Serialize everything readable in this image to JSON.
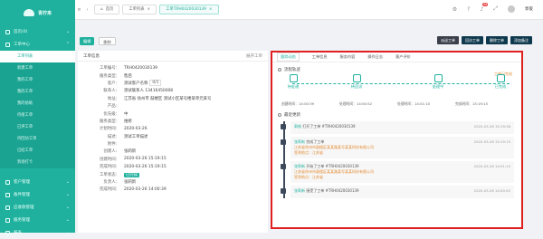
{
  "brand": "青柠来",
  "sidebar": {
    "items": [
      {
        "label": "首页(0)"
      },
      {
        "label": "工单中心"
      }
    ],
    "subitems": [
      {
        "label": "工单列表"
      },
      {
        "label": "新建工单"
      },
      {
        "label": "我的工单"
      },
      {
        "label": "我的工单"
      },
      {
        "label": "我的协助"
      },
      {
        "label": "待接工单"
      },
      {
        "label": "已评工单"
      },
      {
        "label": "待回访工单"
      },
      {
        "label": "已结工单"
      },
      {
        "label": "到场打卡"
      }
    ],
    "bottom": [
      {
        "label": "客户管理"
      },
      {
        "label": "备件管理"
      },
      {
        "label": "应收款管理"
      },
      {
        "label": "服务管理"
      },
      {
        "label": "报表"
      }
    ]
  },
  "topbar": {
    "home": "首页",
    "tab1": "工单列表",
    "tab2": "工单TRH0420030139",
    "badge": "99",
    "user": "郭俊"
  },
  "toolbar": {
    "edit": "编辑",
    "delete": "删除",
    "actions": [
      "派送工单",
      "回访工单",
      "删除工单",
      "添加备注"
    ]
  },
  "left": {
    "title": "工单信息",
    "link": "展开工单",
    "rows": [
      {
        "k": "工单编号：",
        "v": "TRH0420030139"
      },
      {
        "k": "服务类型：",
        "v": "售后"
      },
      {
        "k": "客户：",
        "v": "测试客户名称",
        "extra": "0/1"
      },
      {
        "k": "联系人：",
        "v": "测试联系人 13416450008"
      },
      {
        "k": "地址：",
        "v": "江苏省 徐州市 鼓楼区 测试小区某号楼某单元某号"
      },
      {
        "k": "产品：",
        "v": ""
      },
      {
        "k": "优先级：",
        "v": "中"
      },
      {
        "k": "服务类型：",
        "v": "维修"
      },
      {
        "k": "计划时间：",
        "v": "2020-03-26"
      },
      {
        "k": "描述：",
        "v": "测试工单描述"
      },
      {
        "k": "附件：",
        "v": ""
      },
      {
        "k": "创建人：",
        "v": "张莉新"
      },
      {
        "k": "创建时间：",
        "v": "2020-03-26 15:19:15"
      },
      {
        "k": "完成时间：",
        "v": "2020-03-26 15:19:15"
      },
      {
        "k": "工单状态：",
        "v": "已完成",
        "tag": true
      },
      {
        "k": "负责人：",
        "v": "张莉新"
      },
      {
        "k": "完成时间：",
        "v": "2020-03-26 14:00:39"
      }
    ]
  },
  "right": {
    "tabs": [
      "跟踪动态",
      "工单信息",
      "服务内容",
      "操作日志",
      "客户评价"
    ],
    "flow_title": "流程轨迹",
    "done_label": "工单已完成",
    "nodes": [
      "待处理",
      "待回访",
      "处理中",
      "已完成"
    ],
    "times": [
      "创建时间：14:00:39",
      "处理时间：14:00:52",
      "处理时间：14:01:10",
      "完成时间：15:19:15"
    ],
    "recent_title": "最近更新",
    "events": [
      {
        "user": "郭俊",
        "action": "打开了工单 #TRH0420030139",
        "time": "2020-03-26 15:19:38",
        "lines": []
      },
      {
        "user": "张莉新",
        "action": "完成了工单",
        "time": "2020-03-26 15:19:15",
        "lines": [
          "江苏省徐州市鼓楼区某某路某号某某科技有限公司",
          "签到地点：江苏省"
        ]
      },
      {
        "user": "张莉新",
        "action": "开始了工单 #TRH0420030139",
        "time": "2020-03-26 14:01:10",
        "lines": [
          "江苏省徐州市鼓楼区某某路某号某某科技有限公司",
          "签到地点：江苏省"
        ]
      },
      {
        "user": "张莉新",
        "action": "接受了工单 #TRH0420030139",
        "time": "2020-03-26 14:00:52",
        "lines": []
      }
    ]
  }
}
